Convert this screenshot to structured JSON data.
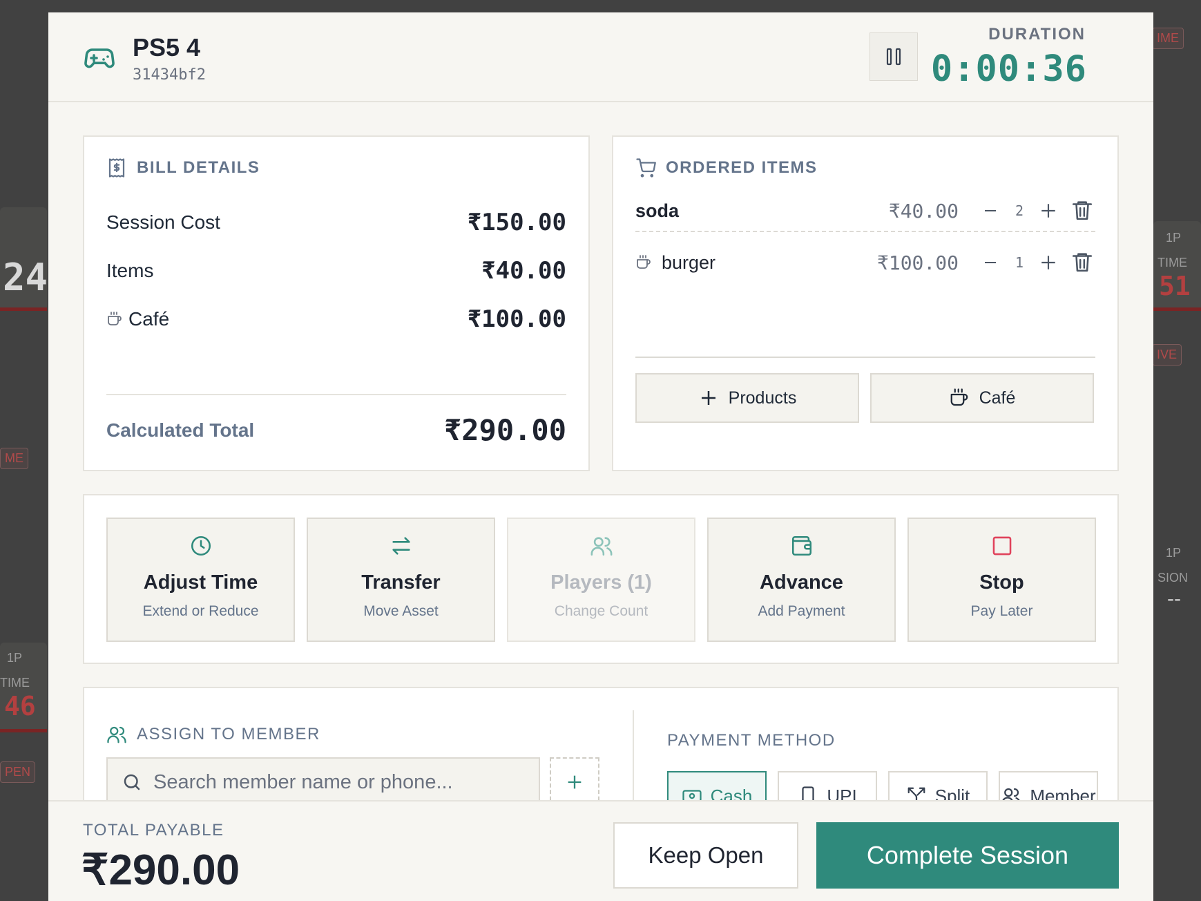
{
  "background": {
    "left_numbers": [
      "24",
      "46"
    ],
    "left_labels": [
      "ME",
      "1P",
      "TIME",
      "PEN"
    ],
    "right_numbers": [
      "51"
    ],
    "right_labels": [
      "IME",
      "1P",
      "TIME",
      "IVE",
      "1P",
      "SION",
      "--"
    ]
  },
  "header": {
    "asset_name": "PS5 4",
    "asset_id": "31434bf2",
    "duration_label": "DURATION",
    "duration_value": "0:00:36"
  },
  "bill": {
    "title": "BILL DETAILS",
    "rows": [
      {
        "label": "Session Cost",
        "value": "₹150.00"
      },
      {
        "label": "Items",
        "value": "₹40.00"
      },
      {
        "label": "Café",
        "value": "₹100.00"
      }
    ],
    "total_label": "Calculated Total",
    "total_value": "₹290.00"
  },
  "orders": {
    "title": "ORDERED ITEMS",
    "items": [
      {
        "name": "soda",
        "price": "₹40.00",
        "qty": "2",
        "icon": "none"
      },
      {
        "name": "burger",
        "price": "₹100.00",
        "qty": "1",
        "icon": "coffee-cup-icon"
      }
    ],
    "add_products_label": "Products",
    "cafe_label": "Café"
  },
  "actions": [
    {
      "title": "Adjust Time",
      "subtitle": "Extend or Reduce",
      "icon": "clock-icon",
      "enabled": true
    },
    {
      "title": "Transfer",
      "subtitle": "Move Asset",
      "icon": "transfer-arrows-icon",
      "enabled": true
    },
    {
      "title": "Players (1)",
      "subtitle": "Change Count",
      "icon": "users-icon",
      "enabled": false
    },
    {
      "title": "Advance",
      "subtitle": "Add Payment",
      "icon": "wallet-icon",
      "enabled": true
    },
    {
      "title": "Stop",
      "subtitle": "Pay Later",
      "icon": "stop-square-icon",
      "enabled": true
    }
  ],
  "assign": {
    "title": "ASSIGN TO MEMBER",
    "search_placeholder": "Search member name or phone..."
  },
  "payment": {
    "title": "PAYMENT METHOD",
    "methods": [
      "Cash",
      "UPI",
      "Split",
      "Member"
    ],
    "selected": "Cash"
  },
  "footer": {
    "total_label": "TOTAL PAYABLE",
    "total_value": "₹290.00",
    "keep_open_label": "Keep Open",
    "complete_label": "Complete Session"
  },
  "colors": {
    "accent": "#2f8a7c",
    "stop": "#e0425b",
    "danger_bg": "#7a2424"
  }
}
